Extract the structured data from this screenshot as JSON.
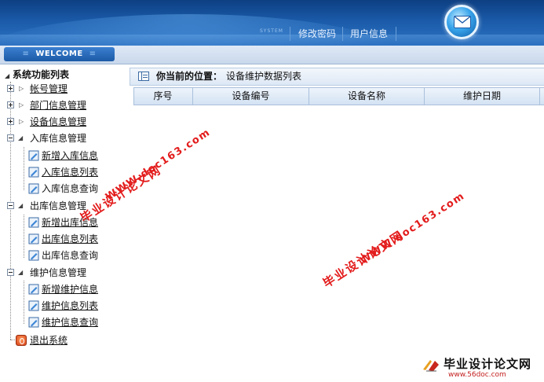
{
  "header": {
    "system_tag": "SYSTEM",
    "nav": [
      {
        "label": "修改密码"
      },
      {
        "label": "用户信息"
      }
    ],
    "mail_icon": "envelope-icon"
  },
  "welcome": {
    "label": "WELCOME",
    "left_deco": "≡",
    "right_deco": "≡"
  },
  "tree": {
    "root_label": "系统功能列表",
    "groups": [
      {
        "label": "帐号管理",
        "expanded": false,
        "children": []
      },
      {
        "label": "部门信息管理",
        "expanded": false,
        "children": []
      },
      {
        "label": "设备信息管理",
        "expanded": false,
        "children": []
      },
      {
        "label": "入库信息管理",
        "expanded": true,
        "children": [
          {
            "label": "新增入库信息"
          },
          {
            "label": "入库信息列表"
          },
          {
            "label": "入库信息查询"
          }
        ]
      },
      {
        "label": "出库信息管理",
        "expanded": true,
        "children": [
          {
            "label": "新增出库信息"
          },
          {
            "label": "出库信息列表"
          },
          {
            "label": "出库信息查询"
          }
        ]
      },
      {
        "label": "维护信息管理",
        "expanded": true,
        "children": [
          {
            "label": "新增维护信息"
          },
          {
            "label": "维护信息列表"
          },
          {
            "label": "维护信息查询"
          }
        ]
      }
    ],
    "exit_label": "退出系统"
  },
  "location": {
    "prefix": "你当前的位置：",
    "path": "设备维护数据列表"
  },
  "table": {
    "columns": [
      "序号",
      "设备编号",
      "设备名称",
      "维护日期"
    ],
    "rows": []
  },
  "watermarks": {
    "site_name": "毕业设计论文网",
    "site_url": "WWW.doc163.com"
  },
  "footer_logo": {
    "title": "毕业设计论文网",
    "url": "www.56doc.com"
  },
  "colors": {
    "header_dark": "#0d3f82",
    "header_light": "#2d74c4",
    "watermark_red": "#e31b1b"
  }
}
